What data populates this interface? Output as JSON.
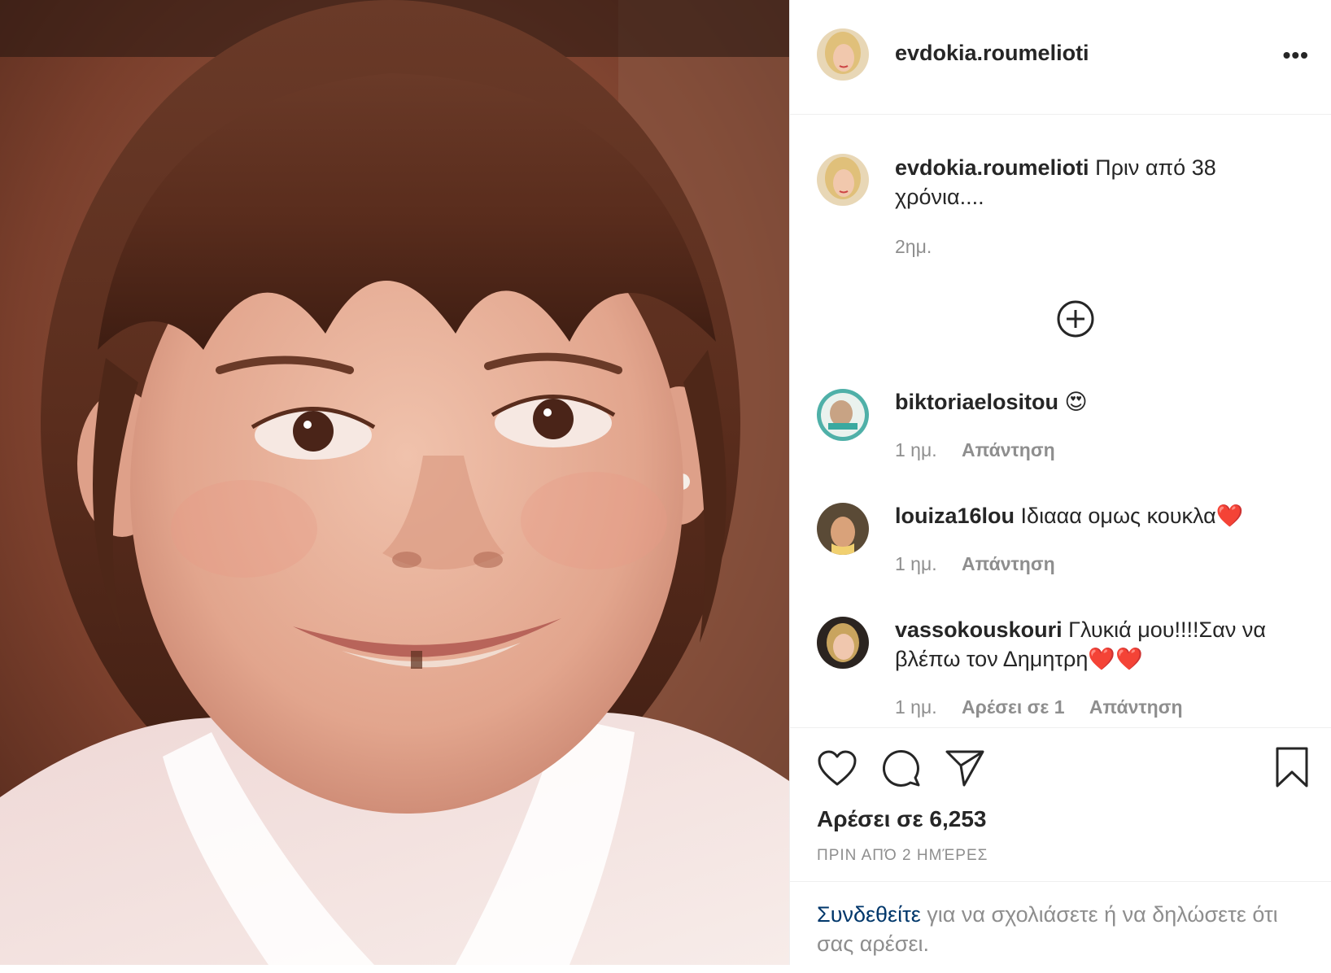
{
  "post": {
    "username": "evdokia.roumelioti",
    "more_label": "•••",
    "caption_user": "evdokia.roumelioti",
    "caption_text": "Πριν από 38 χρόνια....",
    "caption_age": "2ημ.",
    "load_more_icon": "plus-circle-icon"
  },
  "comments": [
    {
      "user": "biktoriaelositou",
      "text": "😍",
      "age": "1 ημ.",
      "likes": "",
      "reply": "Απάντηση"
    },
    {
      "user": "louiza16lou",
      "text": "Ιδιααα ομως κουκλα❤️",
      "age": "1 ημ.",
      "likes": "",
      "reply": "Απάντηση"
    },
    {
      "user": "vassokouskouri",
      "text": "Γλυκιά μου!!!!Σαν να βλέπω τον Δημητρη❤️❤️",
      "age": "1 ημ.",
      "likes": "Αρέσει σε 1",
      "reply": "Απάντηση"
    }
  ],
  "actions": {
    "icons": [
      "heart-icon",
      "comment-icon",
      "share-icon",
      "bookmark-icon"
    ],
    "likes_label": "Αρέσει σε 6,253",
    "time_label": "ΠΡΙΝ ΑΠΌ 2 ΗΜΈΡΕΣ"
  },
  "login": {
    "link": "Συνδεθείτε",
    "rest": " για να σχολιάσετε ή να δηλώσετε ότι σας αρέσει."
  },
  "colors": {
    "link": "#00376b",
    "muted": "#8e8e8e",
    "text": "#262626",
    "border": "#efefef"
  }
}
